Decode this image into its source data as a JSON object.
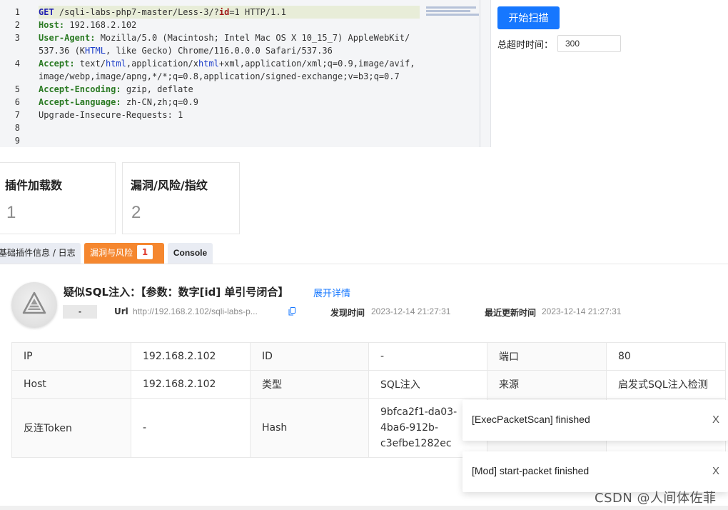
{
  "editor": {
    "line_numbers": [
      "1",
      "2",
      "3",
      "",
      "4",
      "",
      "5",
      "6",
      "7",
      "8",
      "9"
    ],
    "lines": [
      [
        {
          "t": "GET ",
          "c": "m"
        },
        {
          "t": "/sqli-labs-php7-master/Less-3/?",
          "c": "p"
        },
        {
          "t": "id",
          "c": "r"
        },
        {
          "t": "=1 HTTP/1.1",
          "c": "p"
        }
      ],
      [
        {
          "t": "Host:",
          "c": "k"
        },
        {
          "t": " 192.168.2.102",
          "c": "v"
        }
      ],
      [
        {
          "t": "User-Agent:",
          "c": "k"
        },
        {
          "t": " Mozilla/5.0 (Macintosh; Intel Mac OS X 10_15_7) AppleWebKit/",
          "c": "v"
        }
      ],
      [
        {
          "t": "537.36 (K",
          "c": "v"
        },
        {
          "t": "HTML",
          "c": "b"
        },
        {
          "t": ", like Gecko) Chrome/116.0.0.0 Safari/537.36",
          "c": "v"
        }
      ],
      [
        {
          "t": "Accept:",
          "c": "k"
        },
        {
          "t": " text/",
          "c": "v"
        },
        {
          "t": "html",
          "c": "b"
        },
        {
          "t": ",application/x",
          "c": "v"
        },
        {
          "t": "html",
          "c": "b"
        },
        {
          "t": "+xml,application/xml;q=0.9,image/avif,",
          "c": "v"
        }
      ],
      [
        {
          "t": "image/webp,image/apng,*/*;q=0.8,application/signed-exchange;v=b3;q=0.7",
          "c": "v"
        }
      ],
      [
        {
          "t": "Accept-Encoding:",
          "c": "k"
        },
        {
          "t": " gzip, deflate",
          "c": "v"
        }
      ],
      [
        {
          "t": "Accept-Language:",
          "c": "k"
        },
        {
          "t": " zh-CN,zh;q=0.9",
          "c": "v"
        }
      ],
      [
        {
          "t": "Upgrade-Insecure-Requests: 1",
          "c": "v"
        }
      ],
      [],
      []
    ]
  },
  "scan": {
    "start_button": "开始扫描",
    "timeout_label": "总超时时间：",
    "timeout_value": "300"
  },
  "stats": {
    "plugins_label": "插件加载数",
    "plugins_value": "1",
    "vulns_label": "漏洞/风险/指纹",
    "vulns_value": "2"
  },
  "tabs": {
    "base": "基础插件信息 / 日志",
    "vuln": "漏洞与风险",
    "vuln_count": "1",
    "console": "Console"
  },
  "vuln": {
    "title": "疑似SQL注入：【参数：数字[id] 单引号闭合】",
    "expand": "展开详情",
    "level": "-",
    "url_label": "Url",
    "url_value": "http://192.168.2.102/sqli-labs-p...",
    "found_label": "发现时间",
    "found_value": "2023-12-14 21:27:31",
    "updated_label": "最近更新时间",
    "updated_value": "2023-12-14 21:27:31"
  },
  "details": {
    "ip_label": "IP",
    "ip_value": "192.168.2.102",
    "id_label": "ID",
    "id_value": "-",
    "port_label": "端口",
    "port_value": "80",
    "host_label": "Host",
    "host_value": "192.168.2.102",
    "type_label": "类型",
    "type_value": "SQL注入",
    "source_label": "来源",
    "source_value": "启发式SQL注入检测",
    "token_label": "反连Token",
    "token_value": "-",
    "hash_label": "Hash",
    "hash_lines": [
      "9bfca2f1-da03-",
      "4ba6-912b-",
      "c3efbe1282ec"
    ]
  },
  "toasts": [
    {
      "message": "[ExecPacketScan] finished",
      "close": "X"
    },
    {
      "message": "[Mod] start-packet finished",
      "close": "X"
    }
  ],
  "watermark": "CSDN @人间体佐菲"
}
